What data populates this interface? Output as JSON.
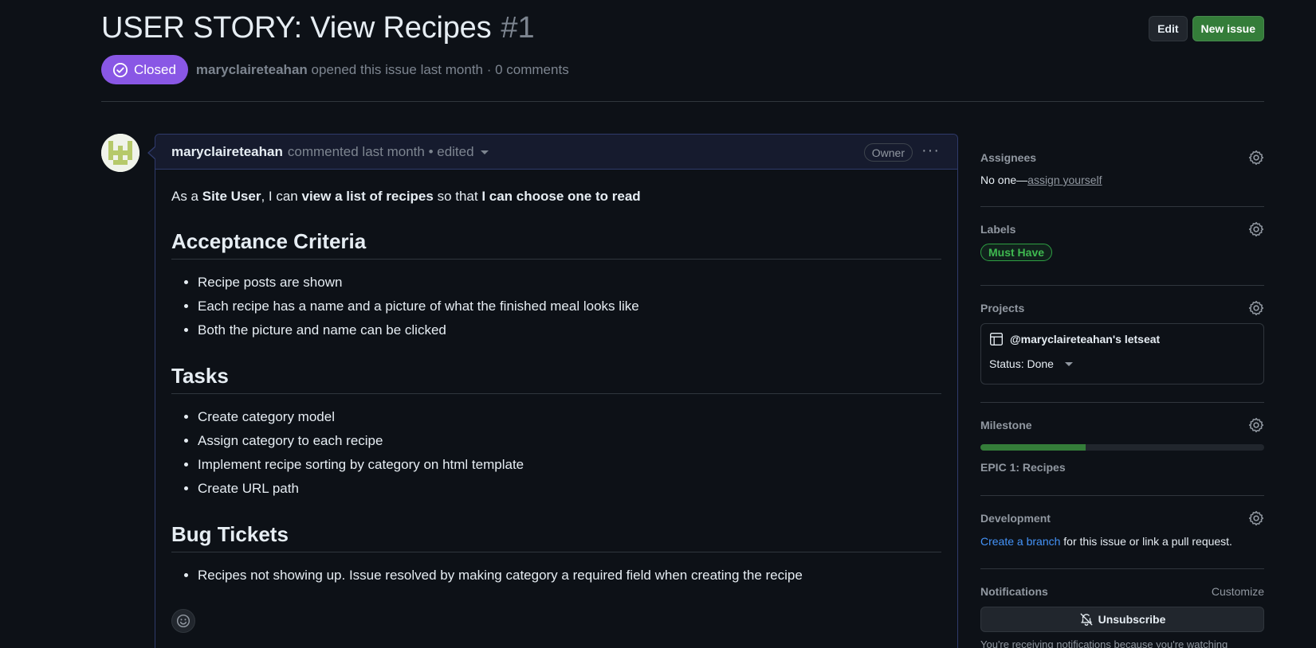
{
  "issue": {
    "title": "USER STORY: View Recipes",
    "number": "#1",
    "state": "Closed",
    "author": "maryclaireteahan",
    "opened_text": "opened this issue last month · 0 comments"
  },
  "actions": {
    "edit": "Edit",
    "new_issue": "New issue"
  },
  "comment": {
    "author": "maryclaireteahan",
    "meta": "commented last month • edited",
    "role": "Owner",
    "intro": {
      "p1": "As a ",
      "b1": "Site User",
      "p2": ", I can ",
      "b2": "view a list of recipes",
      "p3": " so that ",
      "b3": "I can choose one to read"
    },
    "sections": [
      {
        "heading": "Acceptance Criteria",
        "items": [
          "Recipe posts are shown",
          "Each recipe has a name and a picture of what the finished meal looks like",
          "Both the picture and name can be clicked"
        ]
      },
      {
        "heading": "Tasks",
        "items": [
          "Create category model",
          "Assign category to each recipe",
          "Implement recipe sorting by category on html template",
          "Create URL path"
        ]
      },
      {
        "heading": "Bug Tickets",
        "items": [
          "Recipes not showing up. Issue resolved by making category a required field when creating the recipe"
        ]
      }
    ]
  },
  "sidebar": {
    "assignees": {
      "label": "Assignees",
      "none": "No one—",
      "assign_link": "assign yourself"
    },
    "labels": {
      "label": "Labels",
      "items": [
        "Must Have"
      ],
      "color": "#3fb950"
    },
    "projects": {
      "label": "Projects",
      "name": "@maryclaireteahan's letseat",
      "status": "Status: Done"
    },
    "milestone": {
      "label": "Milestone",
      "title": "EPIC 1: Recipes",
      "progress": 0.37
    },
    "development": {
      "label": "Development",
      "link": "Create a branch",
      "rest": " for this issue or link a pull request."
    },
    "notifications": {
      "label": "Notifications",
      "customize": "Customize",
      "unsubscribe": "Unsubscribe",
      "footnote": "You're receiving notifications because you're watching"
    }
  },
  "colors": {
    "closed": "#8957e5",
    "green_button": "#347d39",
    "link": "#4493f8"
  }
}
